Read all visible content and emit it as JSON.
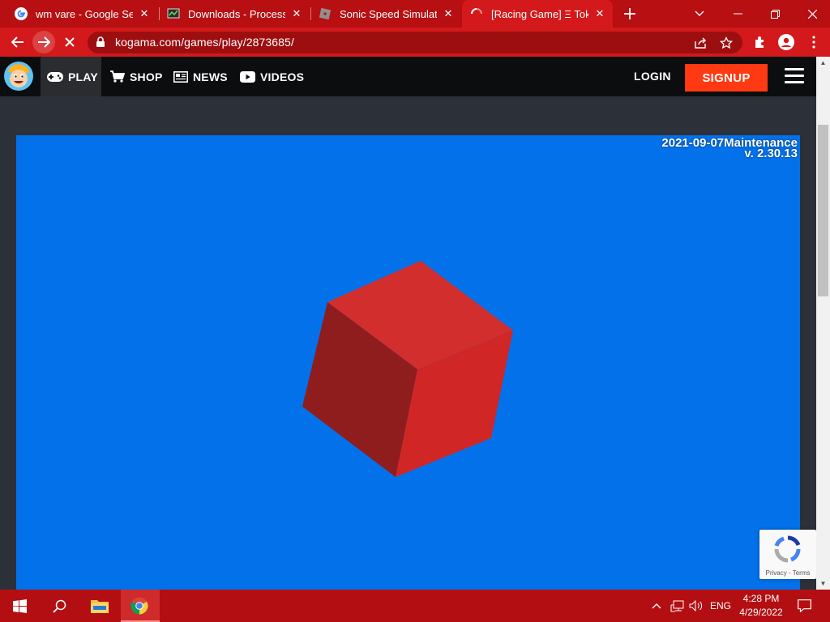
{
  "browser": {
    "tabs": [
      {
        "title": "wm vare - Google Sear",
        "active": false
      },
      {
        "title": "Downloads - Process H",
        "active": false
      },
      {
        "title": "Sonic Speed Simulator",
        "active": false
      },
      {
        "title": "[Racing Game] Ξ Tokyo",
        "active": true
      }
    ],
    "url": "kogama.com/games/play/2873685/"
  },
  "site": {
    "nav": {
      "play": "PLAY",
      "shop": "SHOP",
      "news": "NEWS",
      "videos": "VIDEOS",
      "login": "LOGIN",
      "signup": "SIGNUP"
    },
    "game": {
      "build_date": "2021-09-07Maintenance",
      "version": "v. 2.30.13",
      "background_color": "#0271ea",
      "loading_cube_color": "#d42a2a"
    },
    "recaptcha": {
      "links": "Privacy - Terms"
    }
  },
  "taskbar": {
    "language": "ENG",
    "time": "4:28 PM",
    "date": "4/29/2022"
  },
  "colors": {
    "browser_accent": "#d3191b",
    "signup_button": "#ff3a12",
    "taskbar": "#b30f12"
  }
}
